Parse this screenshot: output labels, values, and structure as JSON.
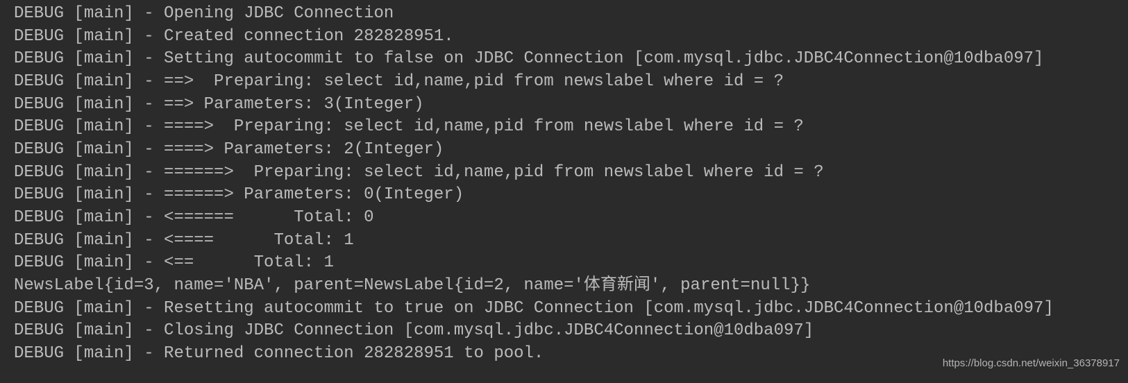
{
  "console": {
    "lines": [
      "DEBUG [main] - Opening JDBC Connection",
      "DEBUG [main] - Created connection 282828951.",
      "DEBUG [main] - Setting autocommit to false on JDBC Connection [com.mysql.jdbc.JDBC4Connection@10dba097]",
      "DEBUG [main] - ==>  Preparing: select id,name,pid from newslabel where id = ?",
      "DEBUG [main] - ==> Parameters: 3(Integer)",
      "DEBUG [main] - ====>  Preparing: select id,name,pid from newslabel where id = ?",
      "DEBUG [main] - ====> Parameters: 2(Integer)",
      "DEBUG [main] - ======>  Preparing: select id,name,pid from newslabel where id = ?",
      "DEBUG [main] - ======> Parameters: 0(Integer)",
      "DEBUG [main] - <======      Total: 0",
      "DEBUG [main] - <====      Total: 1",
      "DEBUG [main] - <==      Total: 1",
      "NewsLabel{id=3, name='NBA', parent=NewsLabel{id=2, name='体育新闻', parent=null}}",
      "DEBUG [main] - Resetting autocommit to true on JDBC Connection [com.mysql.jdbc.JDBC4Connection@10dba097]",
      "DEBUG [main] - Closing JDBC Connection [com.mysql.jdbc.JDBC4Connection@10dba097]",
      "DEBUG [main] - Returned connection 282828951 to pool."
    ]
  },
  "watermark": "https://blog.csdn.net/weixin_36378917",
  "colors": {
    "background": "#2b2b2b",
    "text": "#bbbbbb"
  }
}
